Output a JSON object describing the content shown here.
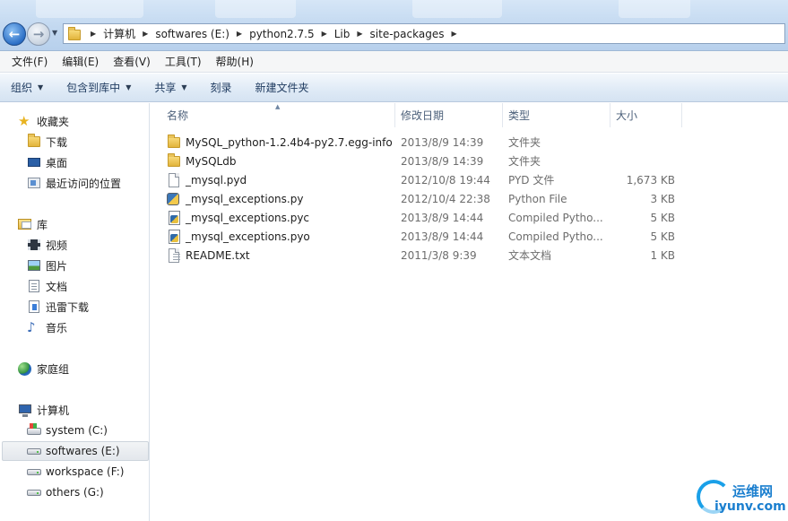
{
  "address_bar": {
    "crumbs": [
      "计算机",
      "softwares (E:)",
      "python2.7.5",
      "Lib",
      "site-packages"
    ]
  },
  "menu": [
    "文件(F)",
    "编辑(E)",
    "查看(V)",
    "工具(T)",
    "帮助(H)"
  ],
  "commands": {
    "organize": "组织",
    "include_in_library": "包含到库中",
    "share": "共享",
    "burn": "刻录",
    "new_folder": "新建文件夹"
  },
  "nav": {
    "favorites": "收藏夹",
    "downloads": "下载",
    "desktop": "桌面",
    "recent": "最近访问的位置",
    "libraries": "库",
    "videos": "视频",
    "pictures": "图片",
    "documents": "文档",
    "thunder": "迅雷下载",
    "music": "音乐",
    "homegroup": "家庭组",
    "computer": "计算机",
    "drives": [
      "system (C:)",
      "softwares (E:)",
      "workspace (F:)",
      "others (G:)"
    ],
    "selected_drive": "softwares (E:)"
  },
  "columns": {
    "name": "名称",
    "date": "修改日期",
    "type": "类型",
    "size": "大小"
  },
  "files": [
    {
      "name": "MySQL_python-1.2.4b4-py2.7.egg-info",
      "date": "2013/8/9 14:39",
      "type": "文件夹",
      "size": "",
      "icon": "folder-icon"
    },
    {
      "name": "MySQLdb",
      "date": "2013/8/9 14:39",
      "type": "文件夹",
      "size": "",
      "icon": "folder-icon"
    },
    {
      "name": "_mysql.pyd",
      "date": "2012/10/8 19:44",
      "type": "PYD 文件",
      "size": "1,673 KB",
      "icon": "file-icon"
    },
    {
      "name": "_mysql_exceptions.py",
      "date": "2012/10/4 22:38",
      "type": "Python File",
      "size": "3 KB",
      "icon": "python-file-icon"
    },
    {
      "name": "_mysql_exceptions.pyc",
      "date": "2013/8/9 14:44",
      "type": "Compiled Pytho...",
      "size": "5 KB",
      "icon": "compiled-python-icon"
    },
    {
      "name": "_mysql_exceptions.pyo",
      "date": "2013/8/9 14:44",
      "type": "Compiled Pytho...",
      "size": "5 KB",
      "icon": "compiled-python-icon"
    },
    {
      "name": "README.txt",
      "date": "2011/3/8 9:39",
      "type": "文本文档",
      "size": "1 KB",
      "icon": "text-file-icon"
    }
  ],
  "watermark": {
    "cn": "运维网",
    "en": "iyunv.com"
  }
}
